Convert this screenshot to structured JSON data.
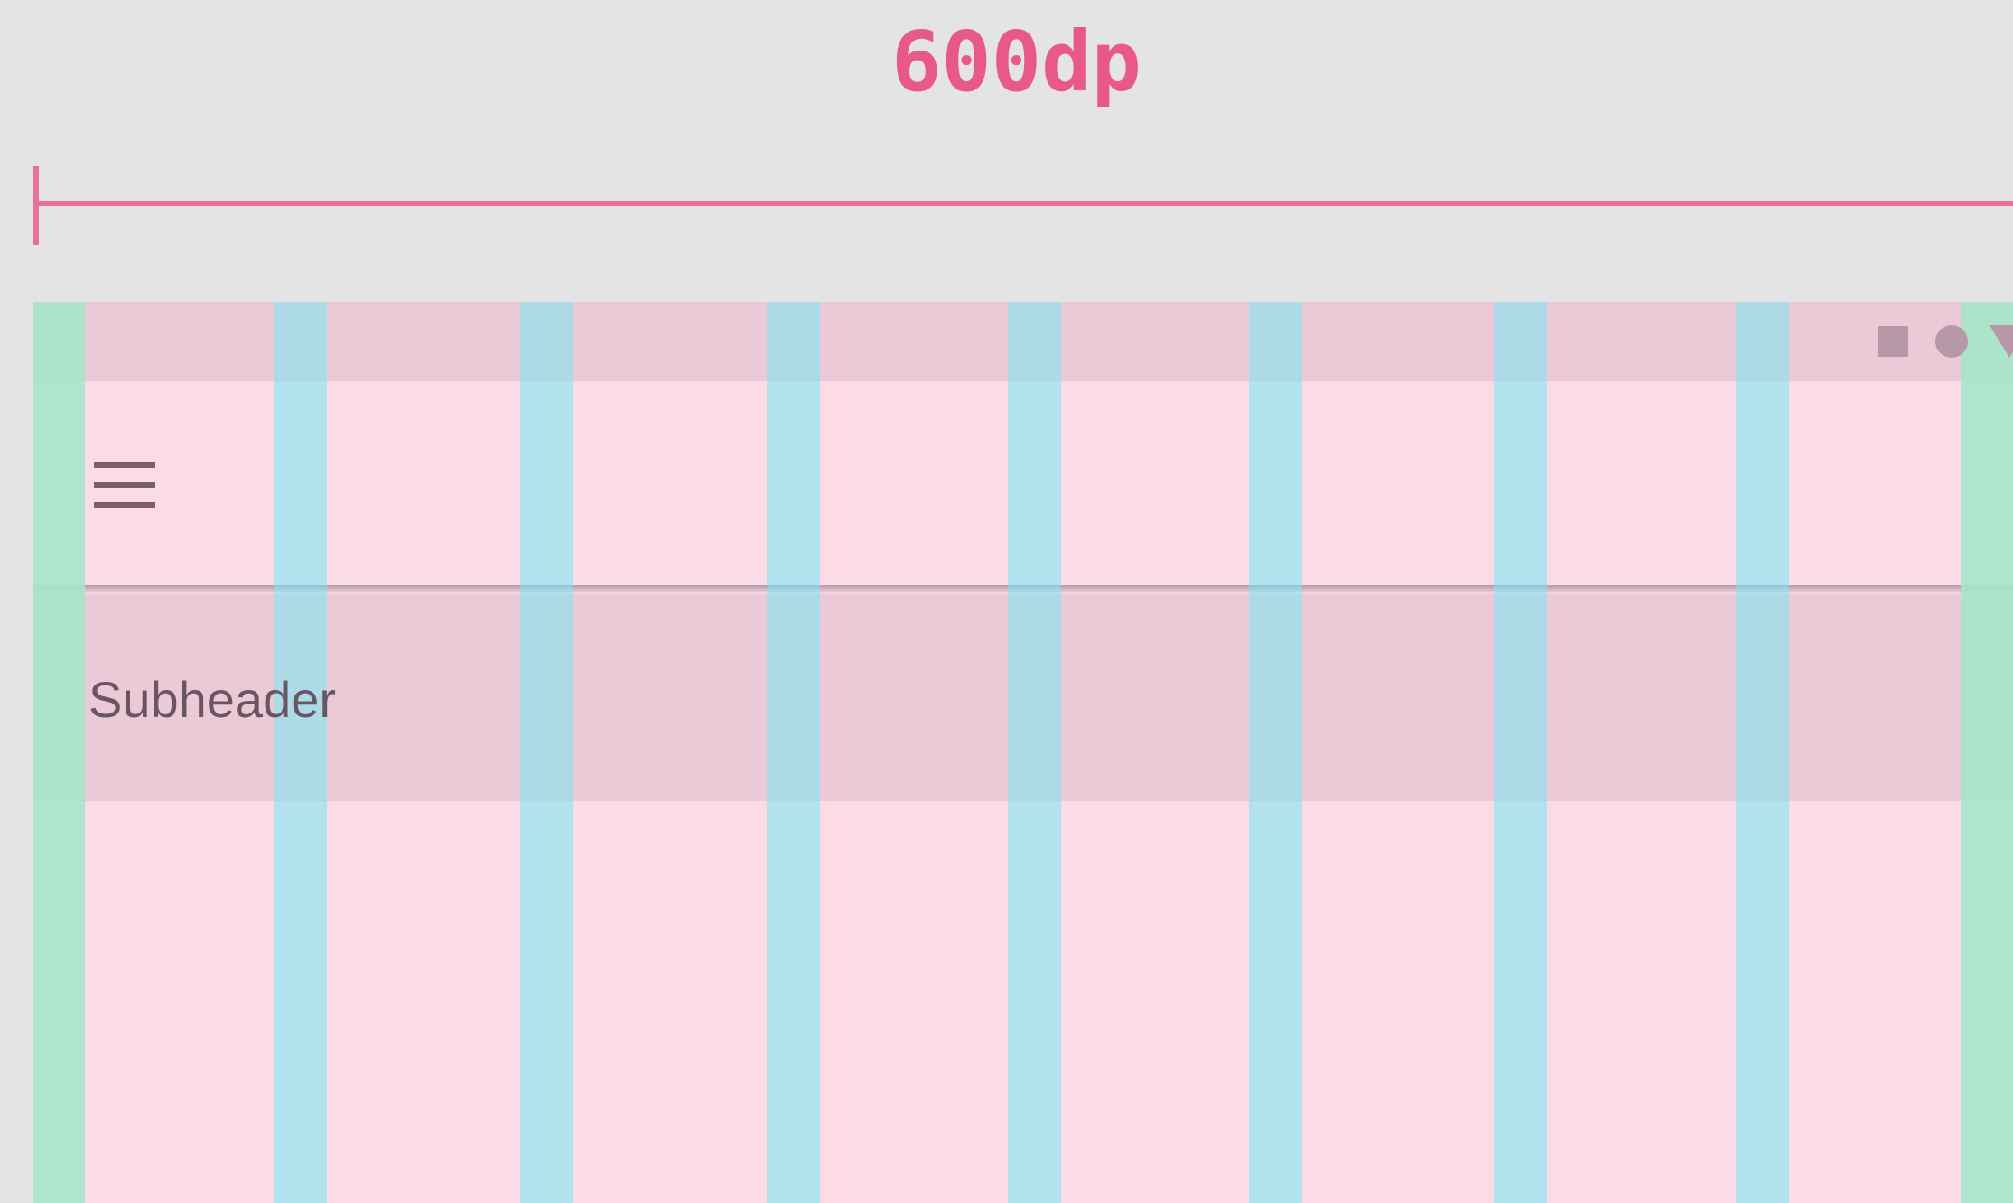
{
  "measure": {
    "label": "600dp"
  },
  "subheader": {
    "label": "Subheader"
  },
  "status_icons": [
    "square-icon",
    "circle-icon",
    "triangle-icon"
  ],
  "header_icon": "menu-icon",
  "colors": {
    "measure": "#e8598a",
    "column": "#fbdce6",
    "gutter": "#78e8f5",
    "margin": "#a6e6c9",
    "background": "#e4e4e4"
  }
}
